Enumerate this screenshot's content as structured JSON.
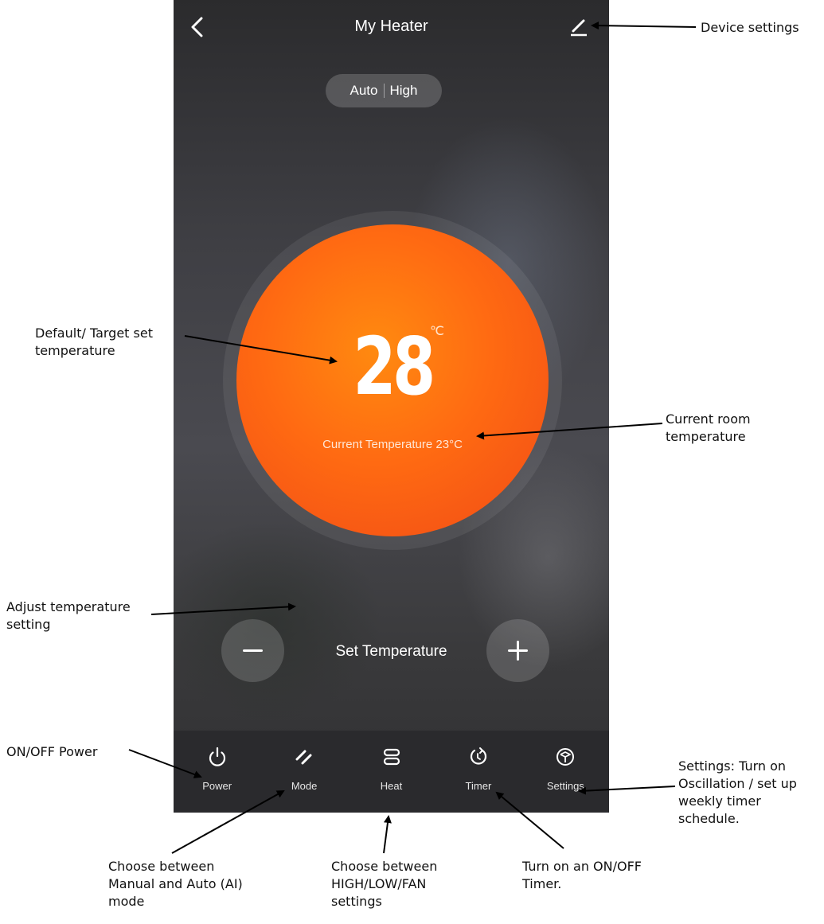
{
  "header": {
    "title": "My Heater"
  },
  "mode_pill": {
    "mode": "Auto",
    "level": "High"
  },
  "dial": {
    "target_temp": "28",
    "unit": "℃",
    "current_temp": "Current Temperature 23°C"
  },
  "controls": {
    "set_temp_label": "Set Temperature"
  },
  "toolbar": {
    "items": [
      {
        "label": "Power",
        "icon": "power-icon"
      },
      {
        "label": "Mode",
        "icon": "mode-icon"
      },
      {
        "label": "Heat",
        "icon": "heat-icon"
      },
      {
        "label": "Timer",
        "icon": "timer-icon"
      },
      {
        "label": "Settings",
        "icon": "settings-icon"
      }
    ]
  },
  "annotations": {
    "device_settings": "Device settings",
    "target_temp": "Default/ Target set temperature",
    "current_room_temp": "Current room temperature",
    "adjust_temp": "Adjust temperature setting",
    "power": "ON/OFF Power",
    "settings": "Settings: Turn on Oscillation / set up weekly timer schedule.",
    "mode": "Choose between Manual and Auto (AI) mode",
    "heat": "Choose between HIGH/LOW/FAN settings",
    "timer": "Turn on an ON/OFF Timer."
  },
  "colors": {
    "dial": "#ff6a12",
    "toolbar": "#2a2a2d",
    "text": "#ffffff"
  }
}
